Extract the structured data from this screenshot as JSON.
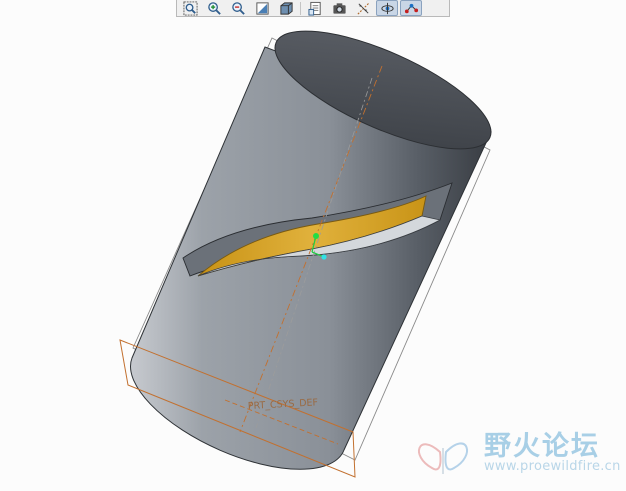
{
  "toolbar": {
    "buttons": [
      {
        "icon": "zoom-window-icon",
        "label": "Zoom Window",
        "active": false
      },
      {
        "icon": "zoom-in-icon",
        "label": "Zoom In",
        "active": false
      },
      {
        "icon": "zoom-out-icon",
        "label": "Zoom Out",
        "active": false
      },
      {
        "icon": "refit-icon",
        "label": "Refit",
        "active": false
      },
      {
        "icon": "shading-icon",
        "label": "Display Style",
        "active": false
      },
      {
        "icon": "saved-views-icon",
        "label": "Saved Orientations",
        "active": false
      },
      {
        "icon": "camera-icon",
        "label": "View Manager",
        "active": false
      },
      {
        "icon": "datum-display-icon",
        "label": "Datum Display",
        "active": false
      },
      {
        "icon": "spin-center-icon",
        "label": "Spin Center",
        "active": true
      },
      {
        "icon": "datum-points-icon",
        "label": "Point Display",
        "active": true
      }
    ]
  },
  "viewport": {
    "datum_plane_label": "PRT_CSYS_DEF",
    "colors": {
      "background": "#fcfcfc",
      "model_body": "#8d949c",
      "model_dark": "#3f444a",
      "cut_surface": "#d7a528",
      "datum_orange": "#c2702f"
    }
  },
  "watermark": {
    "title": "野火论坛",
    "url": "www.proewildfire.cn"
  }
}
